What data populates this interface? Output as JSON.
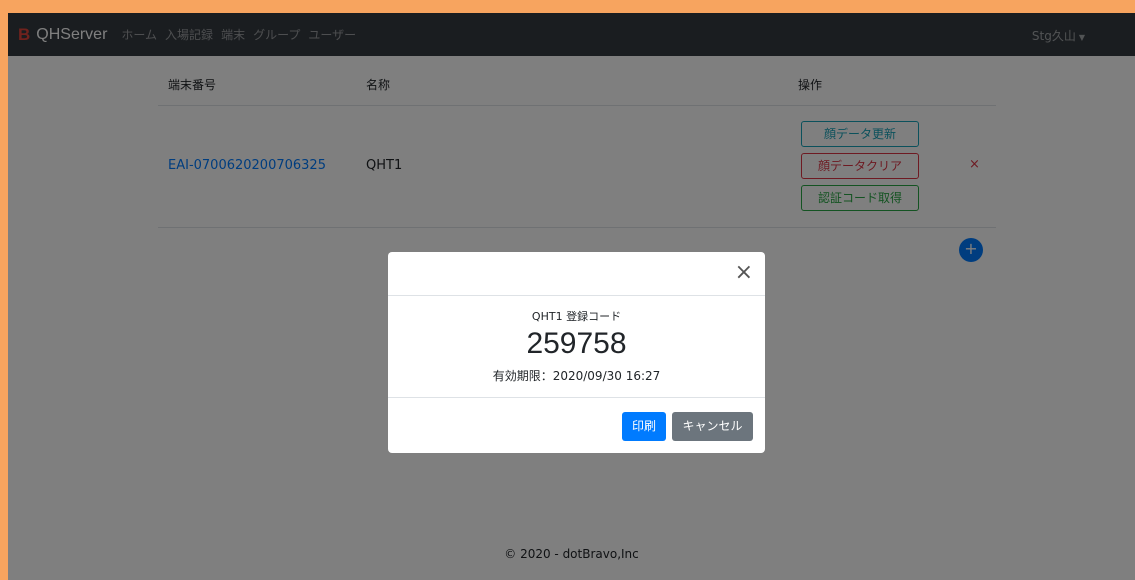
{
  "navbar": {
    "brand_logo": "B",
    "brand_name": "QHServer",
    "links": [
      "ホーム",
      "入場記録",
      "端末",
      "グループ",
      "ユーザー"
    ],
    "user": "Stg久山"
  },
  "table": {
    "headers": {
      "id": "端末番号",
      "name": "名称",
      "ops": "操作"
    },
    "rows": [
      {
        "id": "EAI-0700620200706325",
        "name": "QHT1",
        "buttons": [
          "顔データ更新",
          "顔データクリア",
          "認証コード取得"
        ],
        "delete": "×"
      }
    ],
    "add_symbol": "+"
  },
  "footer": "© 2020 - dotBravo,Inc",
  "modal": {
    "close": "×",
    "label": "QHT1 登録コード",
    "code": "259758",
    "expiry": "有効期限：2020/09/30 16:27",
    "print_label": "印刷",
    "cancel_label": "キャンセル"
  }
}
